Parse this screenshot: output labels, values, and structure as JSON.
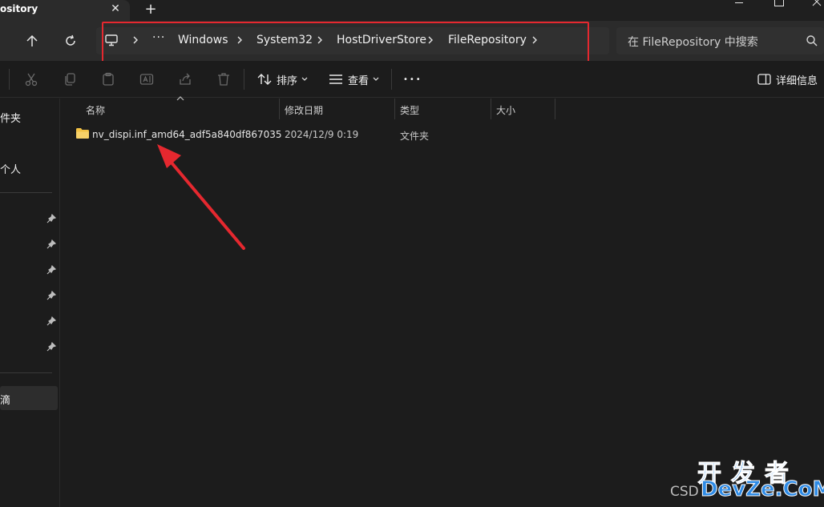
{
  "tab": {
    "title": "ository",
    "close_glyph": "✕",
    "new_tab_glyph": "+"
  },
  "address": {
    "breadcrumb": [
      "Windows",
      "System32",
      "HostDriverStore",
      "FileRepository"
    ],
    "overflow_glyph": "···"
  },
  "search": {
    "placeholder": "在 FileRepository 中搜索"
  },
  "toolbar": {
    "sort_label": "排序",
    "view_label": "查看",
    "details_label": "详细信息",
    "more_glyph": "•••"
  },
  "sidebar": {
    "items": [
      "件夹",
      "个人",
      "滴"
    ]
  },
  "columns": {
    "name": "名称",
    "modified": "修改日期",
    "type": "类型",
    "size": "大小"
  },
  "files": [
    {
      "name": "nv_dispi.inf_amd64_adf5a840df867035",
      "modified": "2024/12/9 0:19",
      "type": "文件夹",
      "size": ""
    }
  ],
  "watermark": {
    "cn": "开发者",
    "prefix": "CSD",
    "domain": "DevZe.CoM"
  },
  "colors": {
    "highlight": "#e5282f",
    "folder": "#f3c244",
    "background": "#1c1c1c"
  }
}
